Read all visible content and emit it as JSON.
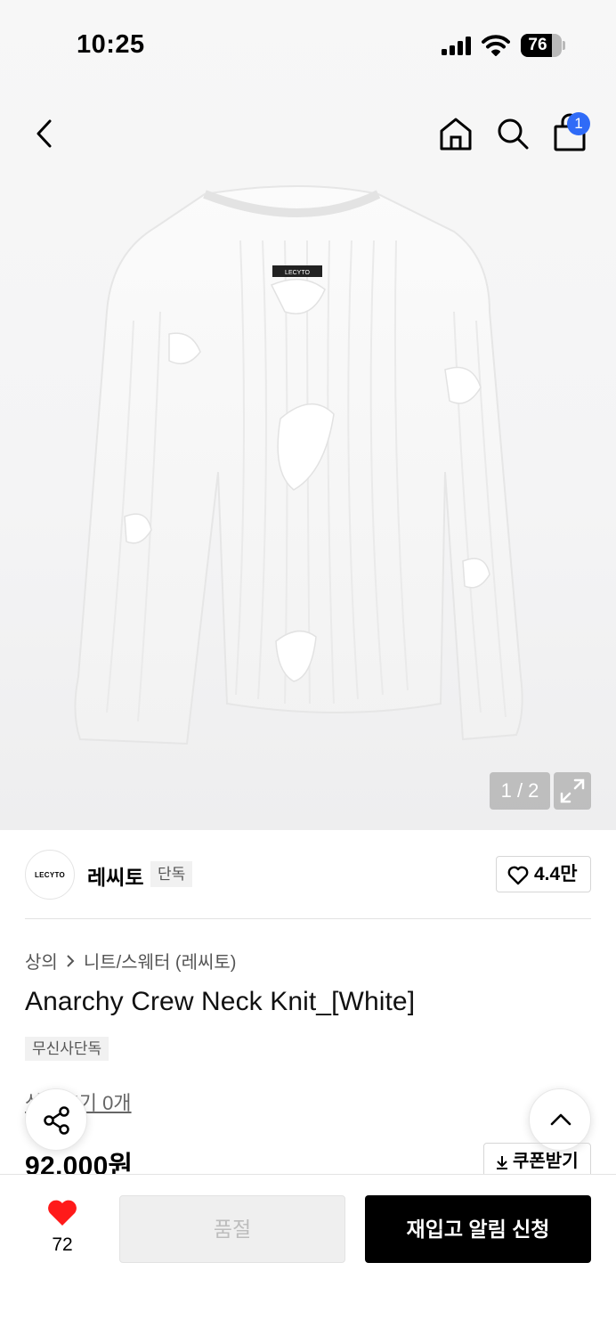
{
  "status_bar": {
    "time": "10:25",
    "battery": "76",
    "battery_level": 0.76
  },
  "header": {
    "cart_count": "1"
  },
  "gallery": {
    "counter": "1 / 2",
    "garment_label": "LECYTO"
  },
  "brand": {
    "logo_text": "LECYTO",
    "name": "레씨토",
    "tag": "단독",
    "likes": "4.4만"
  },
  "product": {
    "breadcrumb": [
      "상의",
      "니트/스웨터 (레씨토)"
    ],
    "title": "Anarchy Crew Neck Knit_[White]",
    "badge": "무신사단독",
    "review_link": "상품후기 0개",
    "price": "92,000원",
    "coupon_label": "쿠폰받기"
  },
  "bottom_bar": {
    "wish_count": "72",
    "soldout_label": "품절",
    "restock_label": "재입고 알림 신청"
  },
  "colors": {
    "accent_badge": "#2f6bf7",
    "heart": "#ff1a1a",
    "primary_button": "#000000"
  }
}
